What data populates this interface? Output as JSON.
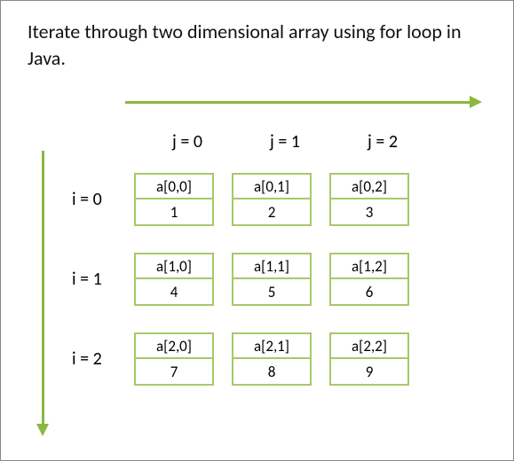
{
  "title": "Iterate through two dimensional array using for loop in Java.",
  "col_labels": [
    "j = 0",
    "j = 1",
    "j = 2"
  ],
  "row_labels": [
    "i = 0",
    "i = 1",
    "i = 2"
  ],
  "cells": [
    [
      {
        "ref": "a[0,0]",
        "val": "1"
      },
      {
        "ref": "a[0,1]",
        "val": "2"
      },
      {
        "ref": "a[0,2]",
        "val": "3"
      }
    ],
    [
      {
        "ref": "a[1,0]",
        "val": "4"
      },
      {
        "ref": "a[1,1]",
        "val": "5"
      },
      {
        "ref": "a[1,2]",
        "val": "6"
      }
    ],
    [
      {
        "ref": "a[2,0]",
        "val": "7"
      },
      {
        "ref": "a[2,1]",
        "val": "8"
      },
      {
        "ref": "a[2,2]",
        "val": "9"
      }
    ]
  ],
  "colors": {
    "accent": "#8bb83f",
    "cell_border": "#a7c96a"
  }
}
